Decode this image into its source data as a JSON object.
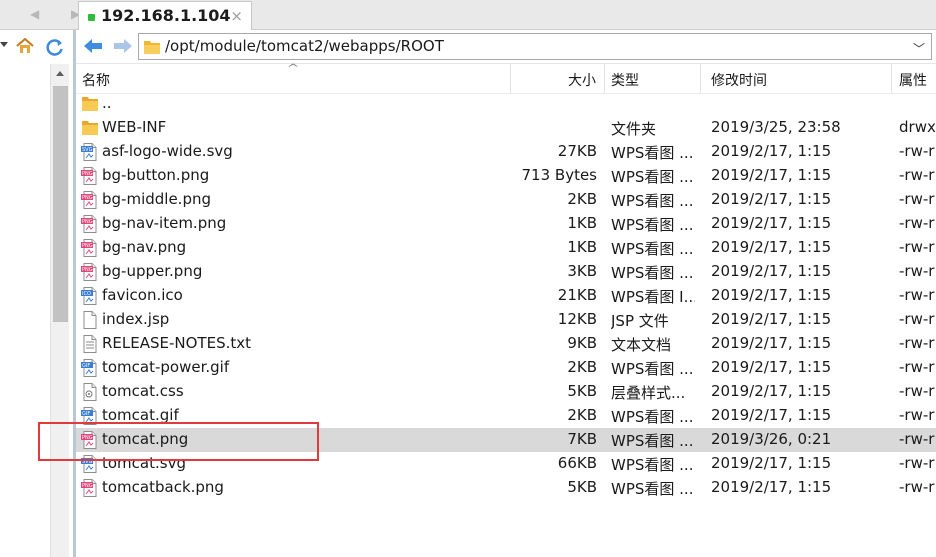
{
  "tab": {
    "title": "192.168.1.104",
    "close": "×"
  },
  "address": {
    "path": "/opt/module/tomcat2/webapps/ROOT"
  },
  "columns": {
    "name": "名称",
    "size": "大小",
    "type": "类型",
    "mtime": "修改时间",
    "attr": "属性"
  },
  "colors": {
    "png_tag": "#e0457a",
    "svg_tag": "#3a7bd5",
    "gif_tag": "#3a7bd5",
    "ico_tag": "#3a7bd5",
    "folder": "#f5c042",
    "selected_row": "#d9d9d9",
    "highlight": "#e23a3a"
  },
  "files": [
    {
      "name": "..",
      "size": "",
      "type": "",
      "mtime": "",
      "attr": "",
      "icon": "folder-icon"
    },
    {
      "name": "WEB-INF",
      "size": "",
      "type": "文件夹",
      "mtime": "2019/3/25, 23:58",
      "attr": "drwx",
      "icon": "folder-icon"
    },
    {
      "name": "asf-logo-wide.svg",
      "size": "27KB",
      "type": "WPS看图 ...",
      "mtime": "2019/2/17, 1:15",
      "attr": "-rw-r",
      "icon": "svg-file-icon"
    },
    {
      "name": "bg-button.png",
      "size": "713 Bytes",
      "type": "WPS看图 ...",
      "mtime": "2019/2/17, 1:15",
      "attr": "-rw-r",
      "icon": "png-file-icon"
    },
    {
      "name": "bg-middle.png",
      "size": "2KB",
      "type": "WPS看图 ...",
      "mtime": "2019/2/17, 1:15",
      "attr": "-rw-r",
      "icon": "png-file-icon"
    },
    {
      "name": "bg-nav-item.png",
      "size": "1KB",
      "type": "WPS看图 ...",
      "mtime": "2019/2/17, 1:15",
      "attr": "-rw-r",
      "icon": "png-file-icon"
    },
    {
      "name": "bg-nav.png",
      "size": "1KB",
      "type": "WPS看图 ...",
      "mtime": "2019/2/17, 1:15",
      "attr": "-rw-r",
      "icon": "png-file-icon"
    },
    {
      "name": "bg-upper.png",
      "size": "3KB",
      "type": "WPS看图 ...",
      "mtime": "2019/2/17, 1:15",
      "attr": "-rw-r",
      "icon": "png-file-icon"
    },
    {
      "name": "favicon.ico",
      "size": "21KB",
      "type": "WPS看图 I...",
      "mtime": "2019/2/17, 1:15",
      "attr": "-rw-r",
      "icon": "ico-file-icon"
    },
    {
      "name": "index.jsp",
      "size": "12KB",
      "type": "JSP 文件",
      "mtime": "2019/2/17, 1:15",
      "attr": "-rw-r",
      "icon": "generic-file-icon"
    },
    {
      "name": "RELEASE-NOTES.txt",
      "size": "9KB",
      "type": "文本文档",
      "mtime": "2019/2/17, 1:15",
      "attr": "-rw-r",
      "icon": "txt-file-icon"
    },
    {
      "name": "tomcat-power.gif",
      "size": "2KB",
      "type": "WPS看图 ...",
      "mtime": "2019/2/17, 1:15",
      "attr": "-rw-r",
      "icon": "gif-file-icon"
    },
    {
      "name": "tomcat.css",
      "size": "5KB",
      "type": "层叠样式...",
      "mtime": "2019/2/17, 1:15",
      "attr": "-rw-r",
      "icon": "css-file-icon"
    },
    {
      "name": "tomcat.gif",
      "size": "2KB",
      "type": "WPS看图 ...",
      "mtime": "2019/2/17, 1:15",
      "attr": "-rw-r",
      "icon": "gif-file-icon"
    },
    {
      "name": "tomcat.png",
      "size": "7KB",
      "type": "WPS看图 ...",
      "mtime": "2019/3/26, 0:21",
      "attr": "-rw-r",
      "icon": "png-file-icon",
      "selected": true
    },
    {
      "name": "tomcat.svg",
      "size": "66KB",
      "type": "WPS看图 ...",
      "mtime": "2019/2/17, 1:15",
      "attr": "-rw-r",
      "icon": "svg-file-icon"
    },
    {
      "name": "tomcatback.png",
      "size": "5KB",
      "type": "WPS看图 ...",
      "mtime": "2019/2/17, 1:15",
      "attr": "-rw-r",
      "icon": "png-file-icon"
    }
  ]
}
